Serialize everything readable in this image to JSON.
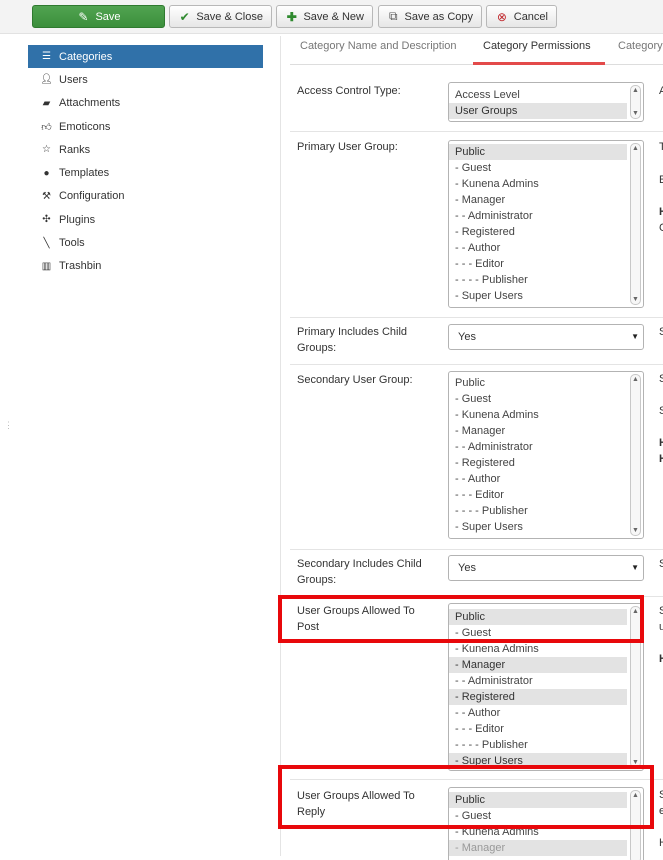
{
  "toolbar": {
    "save": "Save",
    "save_close": "Save & Close",
    "save_new": "Save & New",
    "save_copy": "Save as Copy",
    "cancel": "Cancel"
  },
  "sidebar": {
    "items": [
      {
        "label": "Categories",
        "icon": "list-icon",
        "active": true
      },
      {
        "label": "Users",
        "icon": "user-icon"
      },
      {
        "label": "Attachments",
        "icon": "folder-icon"
      },
      {
        "label": "Emoticons",
        "icon": "thumbs-up-icon"
      },
      {
        "label": "Ranks",
        "icon": "star-icon"
      },
      {
        "label": "Templates",
        "icon": "palette-icon"
      },
      {
        "label": "Configuration",
        "icon": "wrench-icon"
      },
      {
        "label": "Plugins",
        "icon": "puzzle-icon"
      },
      {
        "label": "Tools",
        "icon": "tools-icon"
      },
      {
        "label": "Trashbin",
        "icon": "trash-icon"
      }
    ]
  },
  "tabs": [
    {
      "label": "Category Name and Description"
    },
    {
      "label": "Category Permissions",
      "active": true
    },
    {
      "label": "Category"
    }
  ],
  "form": {
    "access_control": {
      "label": "Access Control Type:",
      "options": [
        "Access Level",
        "User Groups"
      ],
      "selected": "User Groups",
      "desc": "A"
    },
    "primary_group": {
      "label": "Primary User Group:",
      "options": [
        "Public",
        "- Guest",
        "- Kunena Admins",
        "- Manager",
        "- - Administrator",
        "- Registered",
        "- - Author",
        "- - - Editor",
        "- - - - Publisher",
        "- Super Users"
      ],
      "selected": [
        "Public"
      ],
      "desc": [
        "T",
        "E",
        "H",
        "C"
      ]
    },
    "primary_child": {
      "label": "Primary Includes Child Groups:",
      "value": "Yes",
      "desc": "S"
    },
    "secondary_group": {
      "label": "Secondary User Group:",
      "options": [
        "Public",
        "- Guest",
        "- Kunena Admins",
        "- Manager",
        "- - Administrator",
        "- Registered",
        "- - Author",
        "- - - Editor",
        "- - - - Publisher",
        "- Super Users"
      ],
      "selected": [],
      "desc": [
        "S",
        "S",
        "H",
        "H"
      ]
    },
    "secondary_child": {
      "label": "Secondary Includes Child Groups:",
      "value": "Yes",
      "desc": "S"
    },
    "allowed_post": {
      "label": "User Groups Allowed To Post",
      "options": [
        "Public",
        "- Guest",
        "- Kunena Admins",
        "- Manager",
        "- - Administrator",
        "- Registered",
        "- - Author",
        "- - - Editor",
        "- - - - Publisher",
        "- Super Users"
      ],
      "selected": [
        "Public",
        "- Manager",
        "- Registered",
        "- Super Users"
      ],
      "desc": [
        "S",
        "u",
        "H"
      ]
    },
    "allowed_reply": {
      "label": "User Groups Allowed To Reply",
      "options": [
        "Public",
        "- Guest",
        "- Kunena Admins",
        "- Manager"
      ],
      "selected": [
        "Public",
        "- Manager"
      ],
      "desc": [
        "S",
        "e",
        "H"
      ]
    }
  }
}
